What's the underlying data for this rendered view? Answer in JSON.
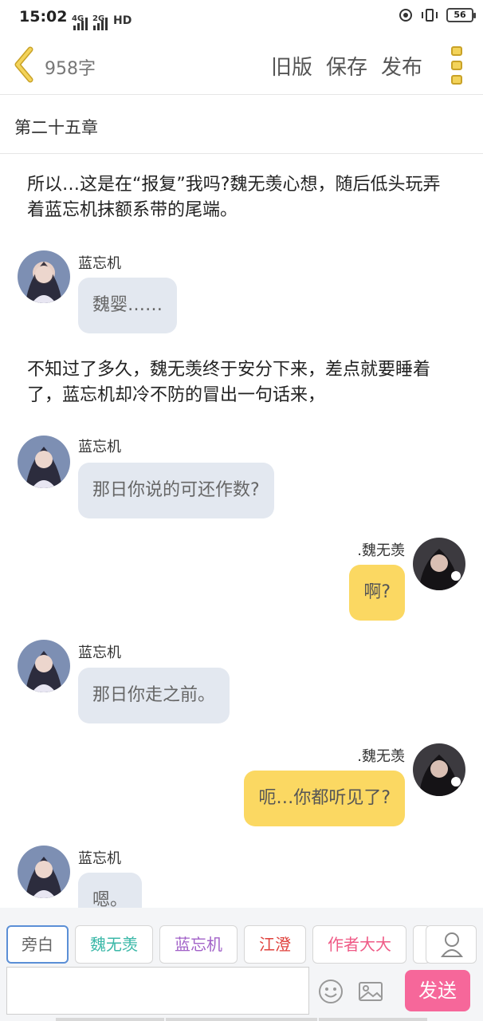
{
  "status_bar": {
    "time": "15:02",
    "net1": "4G",
    "net2": "2G",
    "hd": "HD",
    "battery": "56"
  },
  "header": {
    "word_count": "958字",
    "old_version": "旧版",
    "save": "保存",
    "publish": "发布"
  },
  "chapter": {
    "title": "第二十五章"
  },
  "story": {
    "narration_1": "所以…这是在“报复”我吗?魏无羡心想，随后低头玩弄着蓝忘机抹额系带的尾端。",
    "narration_2": "不知过了多久，魏无羡终于安分下来，差点就要睡着了，蓝忘机却冷不防的冒出一句话来，",
    "messages": [
      {
        "sender": "蓝忘机",
        "text": "魏婴……"
      },
      {
        "sender": "蓝忘机",
        "text": "那日你说的可还作数?"
      },
      {
        "sender": ".魏无羡",
        "text": "啊?"
      },
      {
        "sender": "蓝忘机",
        "text": "那日你走之前。"
      },
      {
        "sender": ".魏无羡",
        "text": "呃…你都听见了?"
      },
      {
        "sender": "蓝忘机",
        "text": "嗯。"
      }
    ]
  },
  "characters": [
    {
      "label": "旁白",
      "color": "#666666"
    },
    {
      "label": "魏无羡",
      "color": "#3bb8a8"
    },
    {
      "label": "蓝忘机",
      "color": "#a262c8"
    },
    {
      "label": "江澄",
      "color": "#e0433e"
    },
    {
      "label": "作者大大",
      "color": "#ef5a86"
    }
  ],
  "composer": {
    "input_value": "",
    "send": "发送"
  },
  "colors": {
    "left_bubble": "#e3e8f0",
    "right_bubble": "#fbd862",
    "send_button": "#f6679a",
    "accent_menu": "#f3d35a"
  }
}
